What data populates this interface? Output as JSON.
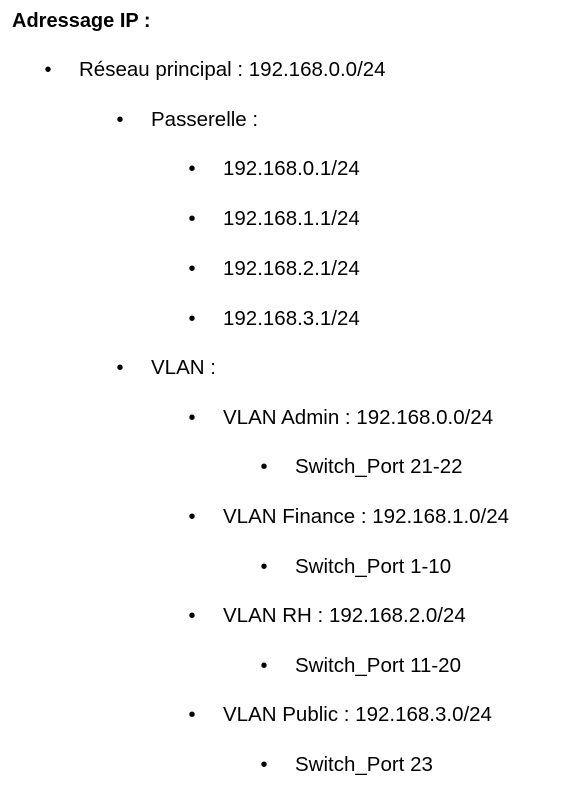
{
  "document": {
    "heading": "Adressage IP :",
    "bullet_glyph": "•",
    "items": [
      {
        "level": 1,
        "text": "Réseau principal : 192.168.0.0/24"
      },
      {
        "level": 2,
        "text": "Passerelle :"
      },
      {
        "level": 3,
        "text": "192.168.0.1/24"
      },
      {
        "level": 3,
        "text": "192.168.1.1/24"
      },
      {
        "level": 3,
        "text": "192.168.2.1/24"
      },
      {
        "level": 3,
        "text": "192.168.3.1/24"
      },
      {
        "level": 2,
        "text": "VLAN :"
      },
      {
        "level": 3,
        "text": "VLAN Admin : 192.168.0.0/24"
      },
      {
        "level": 4,
        "text": "Switch_Port 21-22"
      },
      {
        "level": 3,
        "text": "VLAN Finance : 192.168.1.0/24"
      },
      {
        "level": 4,
        "text": "Switch_Port 1-10"
      },
      {
        "level": 3,
        "text": "VLAN RH : 192.168.2.0/24"
      },
      {
        "level": 4,
        "text": "Switch_Port 11-20"
      },
      {
        "level": 3,
        "text": "VLAN Public : 192.168.3.0/24"
      },
      {
        "level": 4,
        "text": "Switch_Port 23"
      }
    ]
  }
}
